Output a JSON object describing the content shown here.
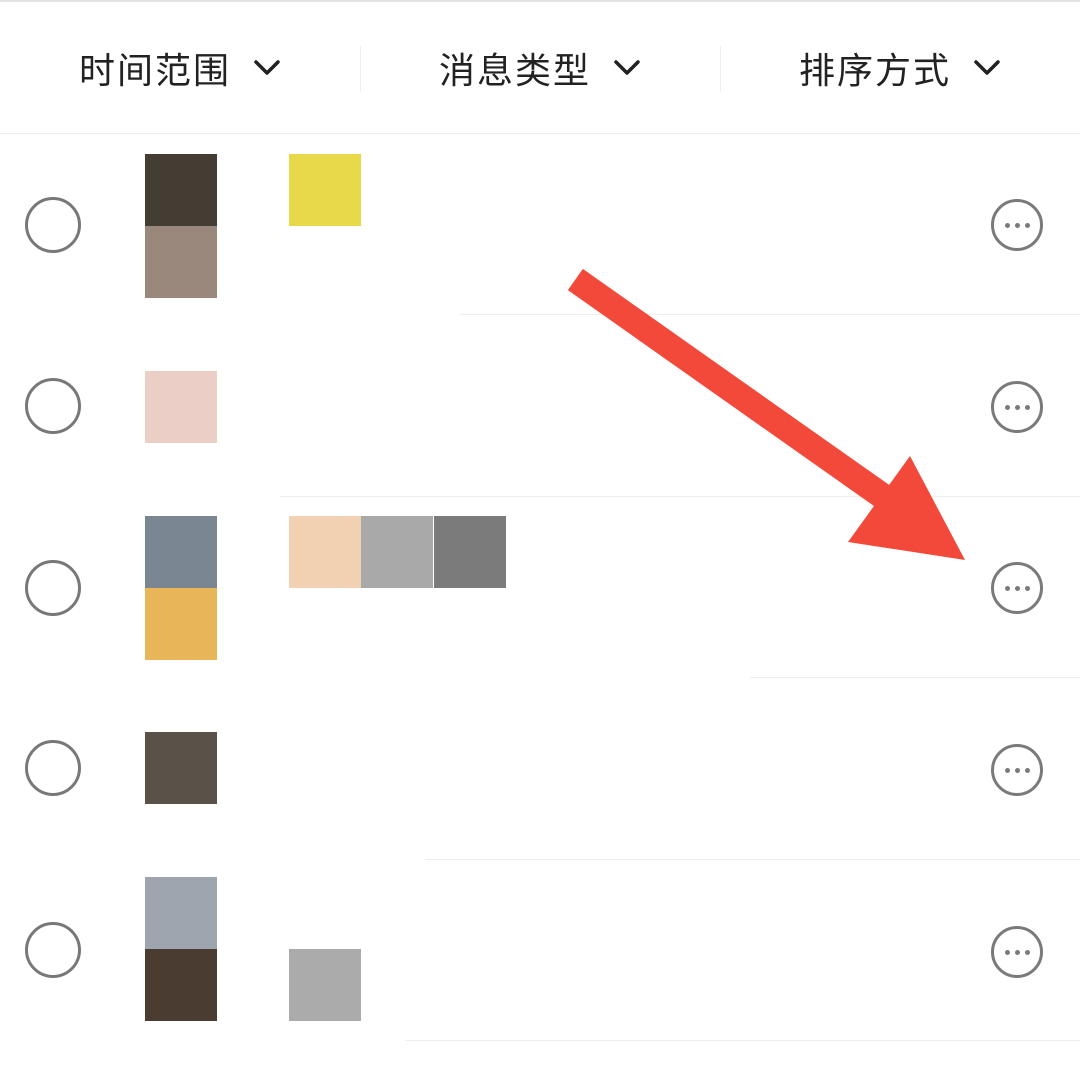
{
  "filters": {
    "time_range": "时间范围",
    "message_type": "消息类型",
    "sort_order": "排序方式"
  },
  "icons": {
    "filter_chevron": "chevron-down-icon",
    "row_more": "more-horizontal-icon",
    "row_select": "radio-circle-icon",
    "annotation": "arrow-pointer-icon"
  },
  "colors": {
    "annotation_arrow": "#f2493a",
    "text": "#222222",
    "icon_gray": "#7a7a7a"
  },
  "rows": [
    {
      "thumb_blocks": [
        "#433d33",
        "#9a887c"
      ],
      "content_blocks": [
        "#e8d94a"
      ]
    },
    {
      "thumb_blocks": [
        "#ebcfc6"
      ],
      "content_blocks": []
    },
    {
      "thumb_blocks": [
        "#7a8792",
        "#e8b558"
      ],
      "content_blocks": [
        "#f2d1b2",
        "#a9a9a9",
        "#7b7b7b"
      ]
    },
    {
      "thumb_blocks": [
        "#5a5148"
      ],
      "content_blocks": []
    },
    {
      "thumb_blocks": [
        "#9fa5ae",
        "#4b3c32"
      ],
      "content_blocks": [
        "#ababab"
      ]
    }
  ]
}
